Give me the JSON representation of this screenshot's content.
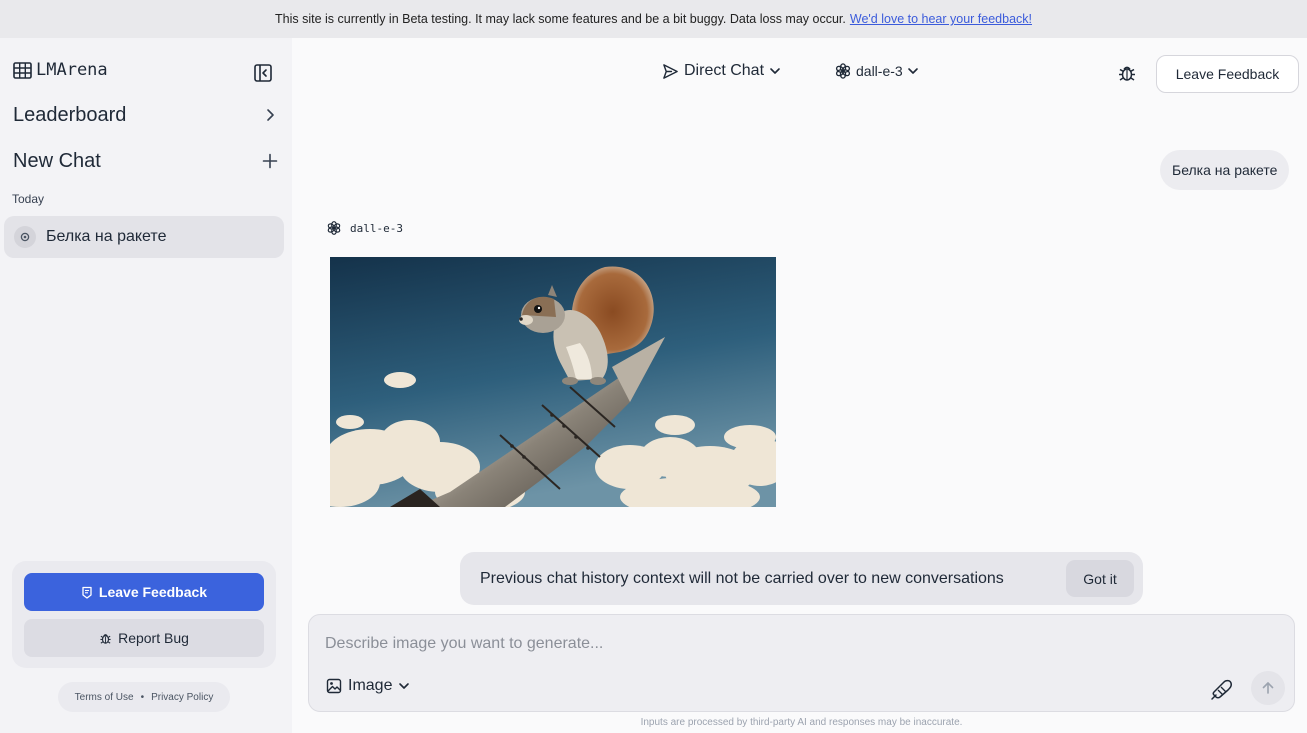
{
  "banner": {
    "text": "This site is currently in Beta testing. It may lack some features and be a bit buggy. Data loss may occur.",
    "link": "We'd love to hear your feedback!"
  },
  "sidebar": {
    "brand": "LMArena",
    "leaderboard": "Leaderboard",
    "new_chat": "New Chat",
    "section": "Today",
    "chats": [
      {
        "title": "Белка на ракете"
      }
    ],
    "leave_feedback": "Leave Feedback",
    "report_bug": "Report Bug",
    "terms": "Terms of Use",
    "separator": "•",
    "privacy": "Privacy Policy"
  },
  "header": {
    "mode": "Direct Chat",
    "model": "dall-e-3",
    "leave_feedback": "Leave Feedback"
  },
  "conversation": {
    "user_message": "Белка на ракете",
    "response_model": "dall-e-3"
  },
  "notice": {
    "text": "Previous chat history context will not be carried over to new conversations",
    "dismiss": "Got it"
  },
  "composer": {
    "placeholder": "Describe image you want to generate...",
    "value": "",
    "mode": "Image",
    "disclaimer": "Inputs are processed by third-party AI and responses may be inaccurate."
  },
  "colors": {
    "accent": "#3b63dd",
    "sidebar_bg": "#f3f3f6",
    "page_bg": "#fafafb"
  }
}
